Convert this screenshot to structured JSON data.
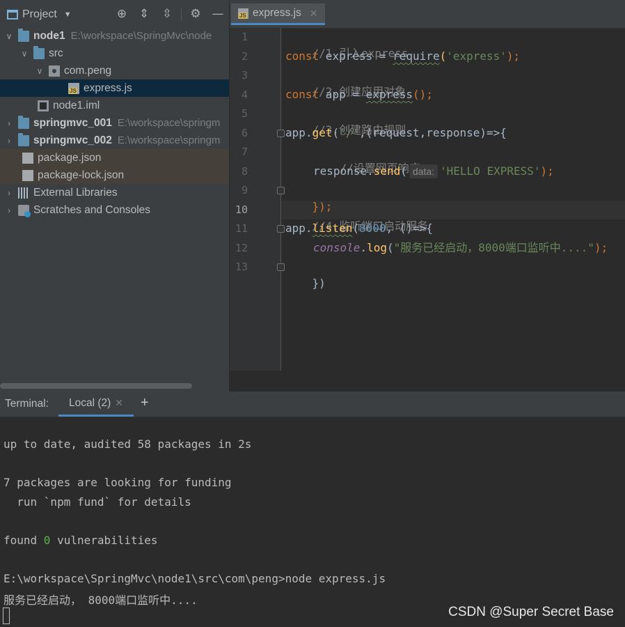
{
  "project_panel": {
    "title": "Project",
    "tree": [
      {
        "name": "node1",
        "path": "E:\\workspace\\SpringMvc\\node"
      },
      {
        "name": "src"
      },
      {
        "name": "com.peng"
      },
      {
        "name": "express.js"
      },
      {
        "name": "node1.iml"
      },
      {
        "name": "springmvc_001",
        "path": "E:\\workspace\\springm"
      },
      {
        "name": "springmvc_002",
        "path": "E:\\workspace\\springm"
      },
      {
        "name": "package.json"
      },
      {
        "name": "package-lock.json"
      },
      {
        "name": "External Libraries"
      },
      {
        "name": "Scratches and Consoles"
      }
    ]
  },
  "editor": {
    "tab_label": "express.js",
    "line_numbers": [
      "1",
      "2",
      "3",
      "4",
      "5",
      "6",
      "7",
      "8",
      "9",
      "10",
      "11",
      "12",
      "13"
    ],
    "current_line": "10",
    "code": {
      "l1": "//1.引入express",
      "l2_kw": "const",
      "l2_var": " express = ",
      "l2_fn": "require",
      "l2_open": "(",
      "l2_str": "'express'",
      "l2_close": ");",
      "l3": "//2.创建应用对象",
      "l4_kw": "const",
      "l4_var": " app = ",
      "l4_fn": "express",
      "l4_close": "();",
      "l5": "//3.创建路由规则",
      "l6_obj": "app.",
      "l6_fn": "get",
      "l6_open": "(",
      "l6_str": "'/'",
      "l6_rest": ",(request,response)=>{",
      "l7": "//设置网页响应",
      "l8_obj": "response.",
      "l8_fn": "send",
      "l8_open": "(",
      "l8_hint": "data:",
      "l8_str": "'HELLO EXPRESS'",
      "l8_close": ");",
      "l9": "});",
      "l10": "//4.监听端口启动服务",
      "l11_obj": "app.",
      "l11_fn": "listen",
      "l11_open": "(",
      "l11_num": "8000",
      "l11_rest": ", ()=>{",
      "l12_obj": "console",
      "l12_dot": ".",
      "l12_fn": "log",
      "l12_open": "(",
      "l12_str": "\"服务已经启动，8000端口监听中....\"",
      "l12_close": ");",
      "l13": "})"
    }
  },
  "terminal": {
    "label": "Terminal:",
    "tab_label": "Local (2)",
    "add_label": "+",
    "lines": {
      "t1": "up to date, audited 58 packages in 2s",
      "t2": "7 packages are looking for funding",
      "t3": "  run `npm fund` for details",
      "t4_pre": "found ",
      "t4_zero": "0",
      "t4_post": " vulnerabilities",
      "t5": "E:\\workspace\\SpringMvc\\node1\\src\\com\\peng>node express.js",
      "t6": "服务已经启动， 8000端口监听中...."
    },
    "watermark": "CSDN @Super Secret Base"
  },
  "colors": {
    "accent": "#4a88c7",
    "selection": "#0d293e",
    "keyword": "#cc7832",
    "string": "#6a8759",
    "function": "#ffc66d",
    "number": "#6897bb"
  }
}
